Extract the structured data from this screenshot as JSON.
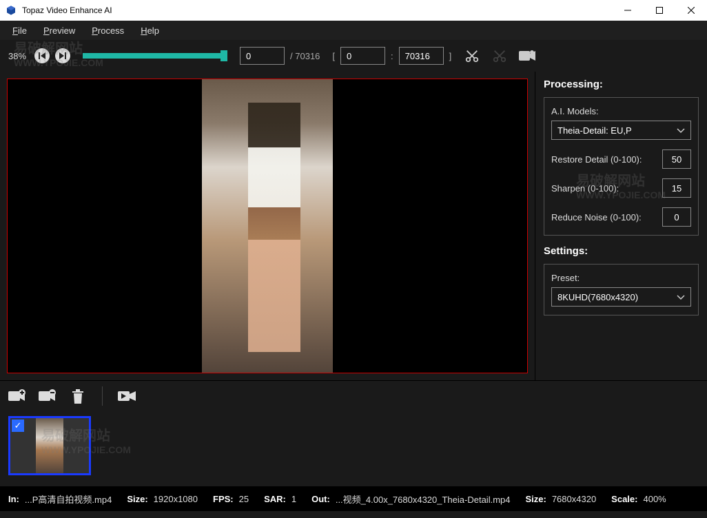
{
  "window": {
    "title": "Topaz Video Enhance AI"
  },
  "menu": {
    "file": "File",
    "preview": "Preview",
    "process": "Process",
    "help": "Help"
  },
  "toolbar": {
    "zoom": "38%",
    "current_frame": "0",
    "total_frames": "70316",
    "range_start": "0",
    "range_end": "70316",
    "slider_percent": 95
  },
  "processing": {
    "title": "Processing:",
    "models_label": "A.I. Models:",
    "model": "Theia-Detail: EU,P",
    "restore_label": "Restore Detail (0-100):",
    "restore_value": "50",
    "sharpen_label": "Sharpen (0-100):",
    "sharpen_value": "15",
    "noise_label": "Reduce Noise (0-100):",
    "noise_value": "0"
  },
  "settings": {
    "title": "Settings:",
    "preset_label": "Preset:",
    "preset_value": "8KUHD(7680x4320)"
  },
  "status": {
    "in_label": "In:",
    "in_value": "...P高清自拍视频.mp4",
    "size1_label": "Size:",
    "size1_value": "1920x1080",
    "fps_label": "FPS:",
    "fps_value": "25",
    "sar_label": "SAR:",
    "sar_value": "1",
    "out_label": "Out:",
    "out_value": "...视频_4.00x_7680x4320_Theia-Detail.mp4",
    "size2_label": "Size:",
    "size2_value": "7680x4320",
    "scale_label": "Scale:",
    "scale_value": "400%"
  },
  "watermark": {
    "text1": "易破解网站",
    "text2": "WWW.YPOJIE.COM"
  }
}
